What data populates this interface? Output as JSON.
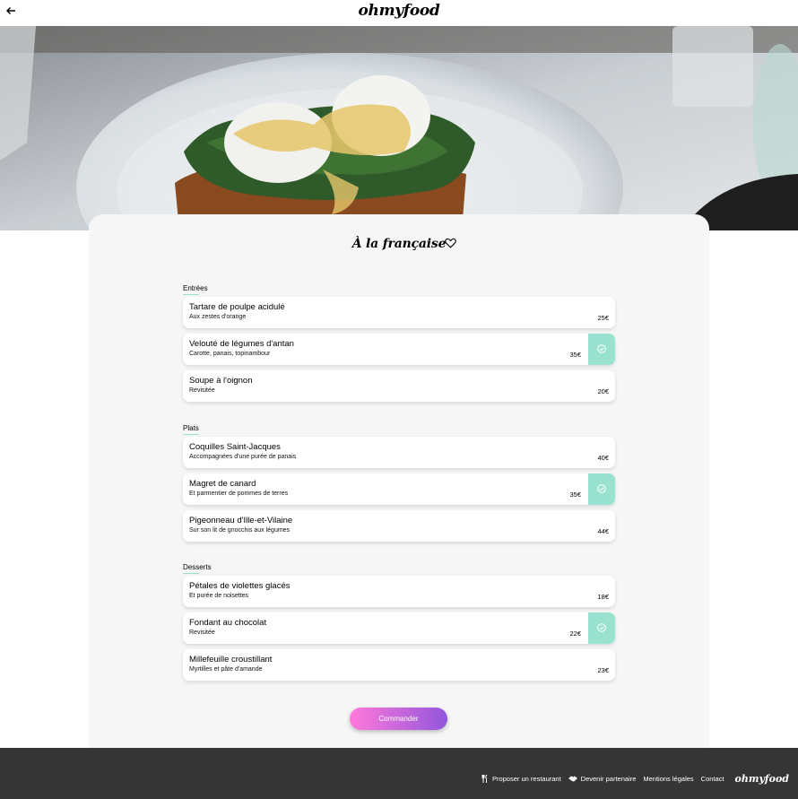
{
  "header": {
    "logo": "ohmyfood",
    "back_icon": "arrow-left-icon"
  },
  "hero": {
    "image": "plate of poached eggs on toast with spinach and hollandaise"
  },
  "menu": {
    "title": "À la française",
    "favorite_icon": "heart-outline-icon",
    "sections": [
      {
        "title": "Entrées",
        "items": [
          {
            "name": "Tartare de poulpe acidulé",
            "desc": "Aux zestes d'orange",
            "price": "25€",
            "selected": false
          },
          {
            "name": "Velouté de légumes d'antan",
            "desc": "Carotte, panais, topinambour",
            "price": "35€",
            "selected": true
          },
          {
            "name": "Soupe à l'oignon",
            "desc": "Revisitée",
            "price": "20€",
            "selected": false
          }
        ]
      },
      {
        "title": "Plats",
        "items": [
          {
            "name": "Coquilles Saint-Jacques",
            "desc": "Accompagnées d'une purée de panais",
            "price": "40€",
            "selected": false
          },
          {
            "name": "Magret de canard",
            "desc": "Et parmentier de pommes de terres",
            "price": "35€",
            "selected": true
          },
          {
            "name": "Pigeonneau d'Ille-et-Vilaine",
            "desc": "Sur son lit de gnocchis aux légumes",
            "price": "44€",
            "selected": false
          }
        ]
      },
      {
        "title": "Desserts",
        "items": [
          {
            "name": "Pétales de violettes glacés",
            "desc": "Et purée de noisettes",
            "price": "18€",
            "selected": false
          },
          {
            "name": "Fondant au chocolat",
            "desc": "Revisitée",
            "price": "22€",
            "selected": true
          },
          {
            "name": "Millefeuille croustillant",
            "desc": "Myrtilles et pâte d'amande",
            "price": "23€",
            "selected": false
          }
        ]
      }
    ],
    "order_button": "Commander"
  },
  "footer": {
    "links": [
      {
        "label": "Proposer un restaurant",
        "icon": "utensils-icon"
      },
      {
        "label": "Devenir partenaire",
        "icon": "handshake-icon"
      },
      {
        "label": "Mentions légales",
        "icon": ""
      },
      {
        "label": "Contact",
        "icon": ""
      }
    ],
    "logo": "ohmyfood"
  },
  "colors": {
    "check_green": "#99e2d0",
    "button_gradient_start": "#ff79da",
    "button_gradient_end": "#9356dc",
    "footer_bg": "#353535",
    "card_bg": "#f6f6f6"
  }
}
